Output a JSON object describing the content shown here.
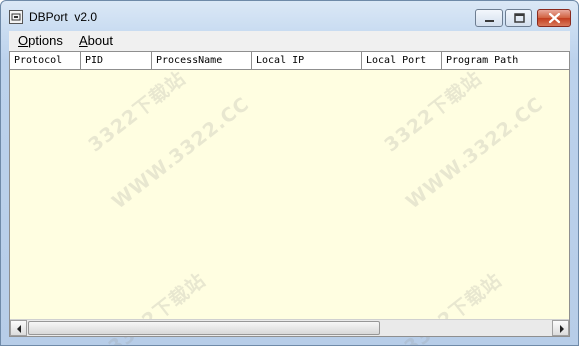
{
  "window": {
    "title": "DBPort  v2.0",
    "icon": "app-icon"
  },
  "caption_buttons": {
    "minimize_icon": "minimize-icon",
    "maximize_icon": "maximize-icon",
    "close_icon": "close-icon"
  },
  "menu": {
    "items": [
      {
        "mnemonic": "O",
        "rest": "ptions"
      },
      {
        "mnemonic": "A",
        "rest": "bout"
      }
    ]
  },
  "table": {
    "columns": [
      "Protocol",
      "PID",
      "ProcessName",
      "Local IP",
      "Local Port",
      "Program Path"
    ],
    "rows": []
  },
  "watermark": {
    "text_a": "3322下载站",
    "text_b": "WWW.3322.CC"
  },
  "colors": {
    "list_background": "#fffee1",
    "close_button": "#c9482a"
  }
}
